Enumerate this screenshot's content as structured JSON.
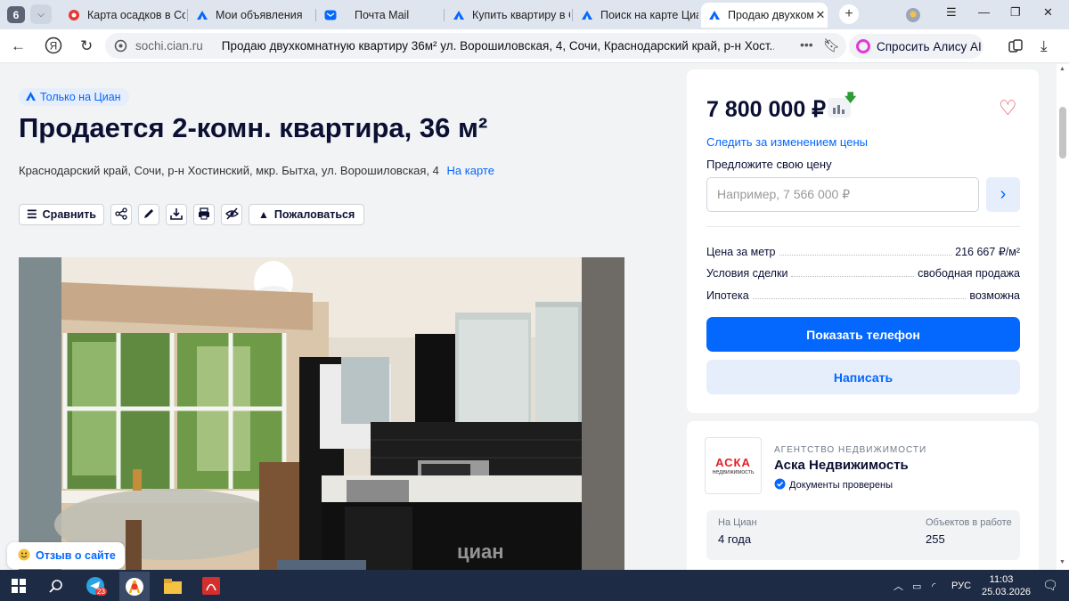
{
  "browser": {
    "tab_count": "6",
    "tabs": [
      {
        "title": "Карта осадков в Сочи",
        "icon": "weather-icon"
      },
      {
        "title": "Мои объявления",
        "icon": "cian-icon"
      },
      {
        "title": "Почта Mail",
        "icon": "mail-icon"
      },
      {
        "title": "Купить квартиру в Сочи",
        "icon": "cian-icon"
      },
      {
        "title": "Поиск на карте Циан",
        "icon": "cian-icon"
      },
      {
        "title": "Продаю двухкомнатную",
        "icon": "cian-icon",
        "active": true
      }
    ],
    "domain": "sochi.cian.ru",
    "page_title": "Продаю двухкомнатную квартиру 36м² ул. Ворошиловская, 4, Сочи, Краснодарский край, р-н Хост...",
    "alice_label": "Спросить Алису AI"
  },
  "listing": {
    "badge": "Только на Циан",
    "title": "Продается 2-комн. квартира, 36 м²",
    "address": "Краснодарский край, Сочи, р-н Хостинский, мкр. Бытха, ул. Ворошиловская, 4",
    "map_link": "На карте",
    "compare_label": "Сравнить",
    "complain_label": "Пожаловаться",
    "photo_watermark": "циан"
  },
  "price_card": {
    "price": "7 800 000 ₽",
    "follow_price": "Следить за изменением цены",
    "offer_label": "Предложите свою цену",
    "offer_placeholder": "Например, 7 566 000 ₽",
    "details": [
      {
        "label": "Цена за метр",
        "value": "216 667 ₽/м²"
      },
      {
        "label": "Условия сделки",
        "value": "свободная продажа"
      },
      {
        "label": "Ипотека",
        "value": "возможна"
      }
    ],
    "show_phone": "Показать телефон",
    "write": "Написать"
  },
  "agency": {
    "type": "АГЕНТСТВО НЕДВИЖИМОСТИ",
    "name": "Аска Недвижимость",
    "verified": "Документы проверены",
    "logo_text": "АСКА",
    "logo_sub": "недвижимость",
    "on_cian_label": "На Циан",
    "on_cian_value": "4 года",
    "objects_label": "Объектов в работе",
    "objects_value": "255"
  },
  "feedback": "Отзыв о сайте",
  "taskbar": {
    "telegram_badge": "23",
    "language": "РУС",
    "time": "11:03",
    "date": "25.03.2026"
  },
  "colors": {
    "accent": "#0468ff",
    "heart": "#e0474c",
    "taskbar": "#1e2b44",
    "agency_red": "#e02127"
  }
}
